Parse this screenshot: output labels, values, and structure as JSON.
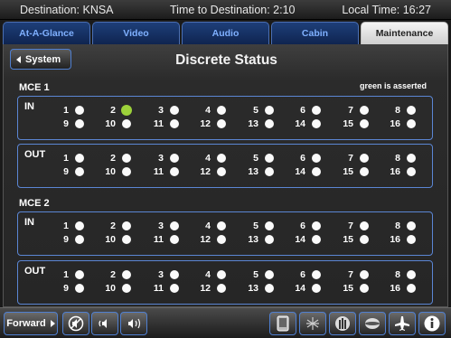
{
  "status_bar": {
    "destination": "Destination: KNSA",
    "time_to_destination": "Time to Destination: 2:10",
    "local_time": "Local Time: 16:27"
  },
  "tabs": [
    "At-A-Glance",
    "Video",
    "Audio",
    "Cabin",
    "Maintenance"
  ],
  "active_tab": "Maintenance",
  "header": {
    "back_label": "System",
    "title": "Discrete Status"
  },
  "legend": "green is asserted",
  "sections": [
    {
      "title": "MCE 1",
      "groups": [
        {
          "label": "IN",
          "asserted": [
            2
          ]
        },
        {
          "label": "OUT",
          "asserted": []
        }
      ]
    },
    {
      "title": "MCE 2",
      "groups": [
        {
          "label": "IN",
          "asserted": []
        },
        {
          "label": "OUT",
          "asserted": []
        }
      ]
    }
  ],
  "discrete_numbers": [
    1,
    2,
    3,
    4,
    5,
    6,
    7,
    8,
    9,
    10,
    11,
    12,
    13,
    14,
    15,
    16
  ],
  "colors": {
    "asserted": "#9cd13a",
    "not_asserted": "#fafafa",
    "accent": "#4f7fd0"
  },
  "bottom_bar": {
    "forward_label": "Forward",
    "icons": [
      "mute-icon",
      "volume-down-icon",
      "volume-up-icon",
      "display-icon",
      "brightness-icon",
      "shade-icon",
      "globe-icon",
      "airplane-icon",
      "info-icon"
    ]
  }
}
